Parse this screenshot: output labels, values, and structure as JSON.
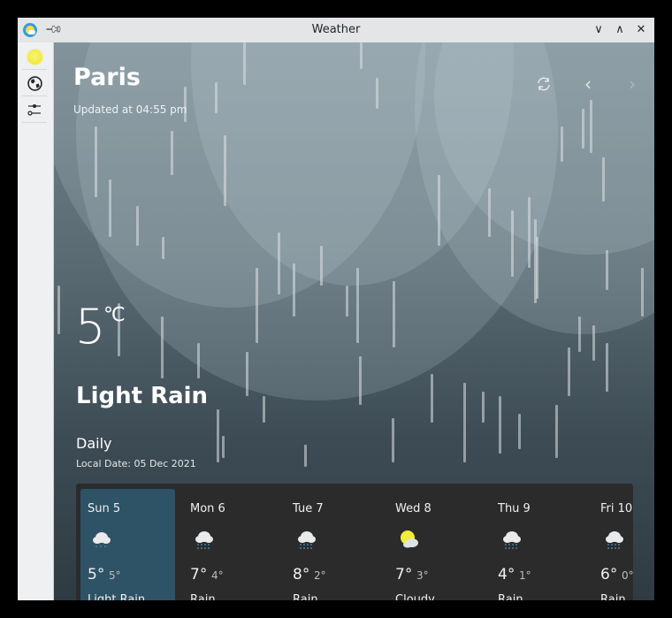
{
  "window": {
    "title": "Weather",
    "app_icon": "weather-app-icon",
    "pin_icon": "pin-icon",
    "controls": {
      "minimize": "chevron-down-icon",
      "maximize": "chevron-up-icon",
      "close": "close-icon"
    }
  },
  "sidebar": {
    "items": [
      {
        "name": "weather",
        "icon": "sun-icon"
      },
      {
        "name": "locations",
        "icon": "globe-icon"
      },
      {
        "name": "settings",
        "icon": "sliders-icon"
      }
    ]
  },
  "header": {
    "city": "Paris",
    "updated": "Updated at 04:55 pm",
    "actions": {
      "refresh": "refresh-icon",
      "previous": "chevron-left-icon",
      "next": "chevron-right-icon"
    }
  },
  "current": {
    "temperature": "5",
    "unit": "℃",
    "condition": "Light Rain"
  },
  "daily": {
    "heading": "Daily",
    "local_date": "Local Date: 05 Dec 2021",
    "days": [
      {
        "day": "Sun 5",
        "icon": "light-rain-icon",
        "high": "5°",
        "low": "5°",
        "description": "Light Rain",
        "selected": true
      },
      {
        "day": "Mon 6",
        "icon": "rain-icon",
        "high": "7°",
        "low": "4°",
        "description": "Rain",
        "selected": false
      },
      {
        "day": "Tue 7",
        "icon": "rain-icon",
        "high": "8°",
        "low": "2°",
        "description": "Rain",
        "selected": false
      },
      {
        "day": "Wed 8",
        "icon": "cloudy-icon",
        "high": "7°",
        "low": "3°",
        "description": "Cloudy",
        "selected": false
      },
      {
        "day": "Thu 9",
        "icon": "rain-icon",
        "high": "4°",
        "low": "1°",
        "description": "Rain",
        "selected": false
      },
      {
        "day": "Fri 10",
        "icon": "rain-icon",
        "high": "6°",
        "low": "0°",
        "description": "Rain",
        "selected": false
      }
    ]
  },
  "colors": {
    "selected_card": "#2e5266",
    "forecast_bg": "#2b2b2b",
    "rain_drop": "#4a7da0"
  }
}
